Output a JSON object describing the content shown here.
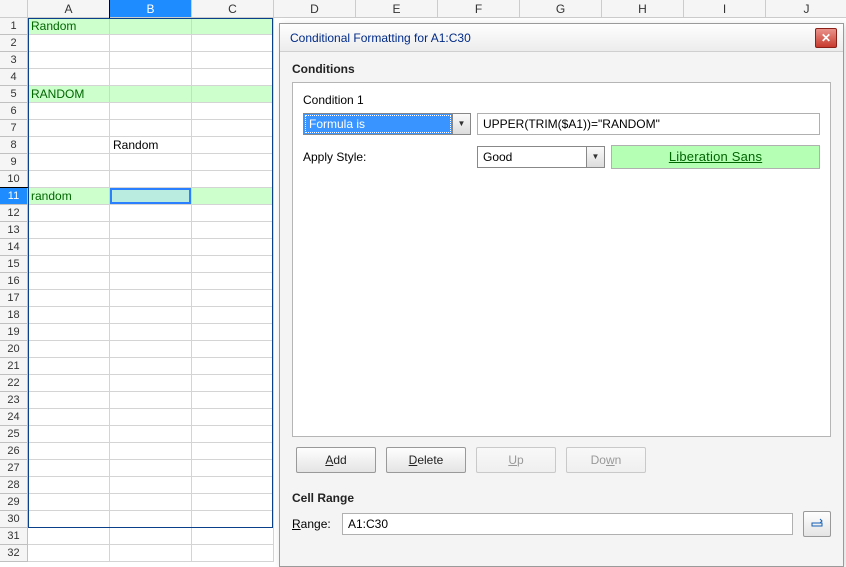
{
  "columns": [
    "A",
    "B",
    "C",
    "D",
    "E",
    "F",
    "G",
    "H",
    "I",
    "J"
  ],
  "selected_column": "B",
  "row_count": 32,
  "selected_row": 11,
  "active_cell": {
    "col": "B",
    "row": 11
  },
  "cell_values": {
    "A1": "Random",
    "A5": "RANDOM",
    "B8": "Random",
    "A11": "random"
  },
  "highlight_rows": [
    1,
    5,
    11
  ],
  "conditional_range": {
    "left_col": "A",
    "right_col": "C",
    "top_row": 1,
    "bottom_row": 30
  },
  "dialog": {
    "title": "Conditional Formatting for A1:C30",
    "sections": {
      "conditions_label": "Conditions",
      "cell_range_label": "Cell Range"
    },
    "condition1": {
      "label": "Condition 1",
      "type_selected": "Formula is",
      "formula": "UPPER(TRIM($A1))=\"RANDOM\"",
      "apply_style_label": "Apply Style:",
      "style_selected": "Good",
      "preview_text": "Liberation Sans"
    },
    "buttons": {
      "add": "Add",
      "delete": "Delete",
      "up": "Up",
      "down": "Down"
    },
    "range": {
      "label": "Range:",
      "value": "A1:C30"
    }
  },
  "chart_data": null
}
